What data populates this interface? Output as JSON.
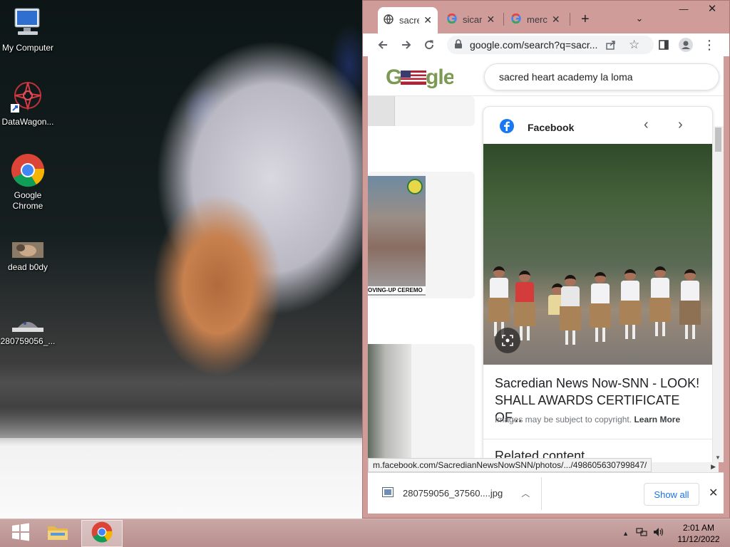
{
  "desktop": {
    "icons": [
      {
        "label": "My Computer"
      },
      {
        "label": "DataWagon..."
      },
      {
        "label": "Google Chrome"
      },
      {
        "label": "dead b0dy"
      },
      {
        "label": "280759056_..."
      }
    ]
  },
  "browser": {
    "tabs": [
      {
        "title": "sacre",
        "active": true
      },
      {
        "title": "sicar",
        "active": false
      },
      {
        "title": "merc",
        "active": false
      }
    ],
    "new_tab": "+",
    "url": "google.com/search?q=sacr...",
    "search_query": "sacred heart academy la loma",
    "thumb_caption": "OVING-UP CEREMO",
    "panel": {
      "source": "Facebook",
      "title": "Sacredian News Now-SNN - LOOK! SHALL AWARDS CERTIFICATE OF...",
      "copyright_note": "Images may be subject to copyright.",
      "learn_more": "Learn More",
      "related": "Related content"
    },
    "status_url": "m.facebook.com/SacredianNewsNowSNN/photos/.../498605630799847/",
    "download": {
      "filename": "280759056_37560....jpg",
      "show_all": "Show all"
    }
  },
  "taskbar": {
    "time": "2:01 AM",
    "date": "11/12/2022"
  },
  "colors": {
    "taskbar": "#c1999a",
    "window_frame": "#cf9c9a",
    "link_blue": "#1a73e8"
  }
}
